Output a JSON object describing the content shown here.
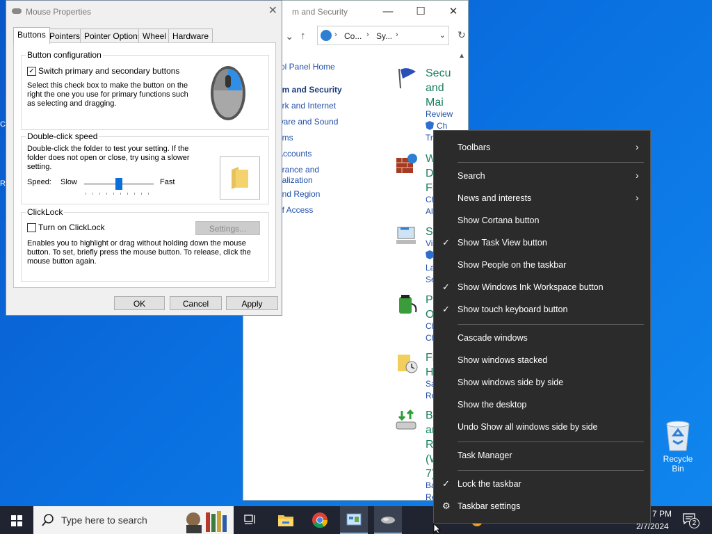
{
  "control_panel": {
    "title": "m and Security",
    "address": {
      "seg1": "Co...",
      "seg2": "Sy..."
    },
    "nav": [
      "rol Panel Home",
      "em and Security",
      "ork and Internet",
      "ware and Sound",
      "ams",
      "Accounts",
      "arance and",
      "nalization",
      "and Region",
      "of Access"
    ],
    "categories": [
      {
        "title_lines": [
          "Secu",
          "and",
          "Mai"
        ],
        "links": [
          "Review",
          "Ch",
          "Tro"
        ]
      },
      {
        "title_lines": [
          "W",
          "De",
          "Fi"
        ],
        "links": [
          "Ch",
          "Al"
        ]
      },
      {
        "title_lines": [
          "Sy"
        ],
        "links": [
          "Vi",
          "La",
          "Se"
        ]
      },
      {
        "title_lines": [
          "Po",
          "O"
        ],
        "links": [
          "Ch",
          "Ch"
        ]
      },
      {
        "title_lines": [
          "Fi",
          "H"
        ],
        "links": [
          "Sa",
          "Re"
        ]
      },
      {
        "title_lines": [
          "Ba",
          "an",
          "Re",
          "(W",
          "7)"
        ],
        "links": [
          "Ba",
          "Re"
        ]
      }
    ]
  },
  "mouse_properties": {
    "title": "Mouse Properties",
    "tabs": [
      "Buttons",
      "Pointers",
      "Pointer Options",
      "Wheel",
      "Hardware"
    ],
    "button_config": {
      "label": "Button configuration",
      "checkbox_label": "Switch primary and secondary buttons",
      "checked": true,
      "desc": [
        "Select this check box to make the button on the",
        "right the one you use for primary functions such",
        "as selecting and dragging."
      ]
    },
    "double_click": {
      "label": "Double-click speed",
      "desc": [
        "Double-click the folder to test your setting. If the",
        "folder does not open or close, try using a slower",
        "setting."
      ],
      "speed_label": "Speed:",
      "slow": "Slow",
      "fast": "Fast",
      "slider_value": 0.5
    },
    "clicklock": {
      "label": "ClickLock",
      "checkbox_label": "Turn on ClickLock",
      "checked": false,
      "settings_button": "Settings...",
      "desc": [
        "Enables you to highlight or drag without holding down the mouse",
        "button. To set, briefly press the mouse button. To release, click the",
        "mouse button again."
      ]
    },
    "buttons": {
      "ok": "OK",
      "cancel": "Cancel",
      "apply": "Apply"
    }
  },
  "context_menu": {
    "items": [
      {
        "label": "Toolbars",
        "submenu": true,
        "checked": false
      },
      {
        "label": "Search",
        "submenu": true,
        "checked": false
      },
      {
        "label": "News and interests",
        "submenu": true,
        "checked": false
      },
      {
        "label": "Show Cortana button",
        "submenu": false,
        "checked": false
      },
      {
        "label": "Show Task View button",
        "submenu": false,
        "checked": true
      },
      {
        "label": "Show People on the taskbar",
        "submenu": false,
        "checked": false
      },
      {
        "label": "Show Windows Ink Workspace button",
        "submenu": false,
        "checked": true
      },
      {
        "label": "Show touch keyboard button",
        "submenu": false,
        "checked": true
      },
      {
        "label": "Cascade windows",
        "submenu": false,
        "checked": false
      },
      {
        "label": "Show windows stacked",
        "submenu": false,
        "checked": false
      },
      {
        "label": "Show windows side by side",
        "submenu": false,
        "checked": false
      },
      {
        "label": "Show the desktop",
        "submenu": false,
        "checked": false
      },
      {
        "label": "Undo Show all windows side by side",
        "submenu": false,
        "checked": false
      },
      {
        "label": "Task Manager",
        "submenu": false,
        "checked": false
      },
      {
        "label": "Lock the taskbar",
        "submenu": false,
        "checked": true
      },
      {
        "label": "Taskbar settings",
        "submenu": false,
        "checked": false,
        "icon": "gear-icon"
      }
    ]
  },
  "taskbar": {
    "search_placeholder": "Type here to search",
    "time": "7 PM",
    "date": "2/7/2024",
    "notification_count": "2",
    "apps": [
      "task-view-icon",
      "file-explorer-icon",
      "chrome-icon",
      "control-panel-icon",
      "mouse-icon"
    ]
  },
  "desktop": {
    "recycle_bin": "Recycle Bin"
  }
}
